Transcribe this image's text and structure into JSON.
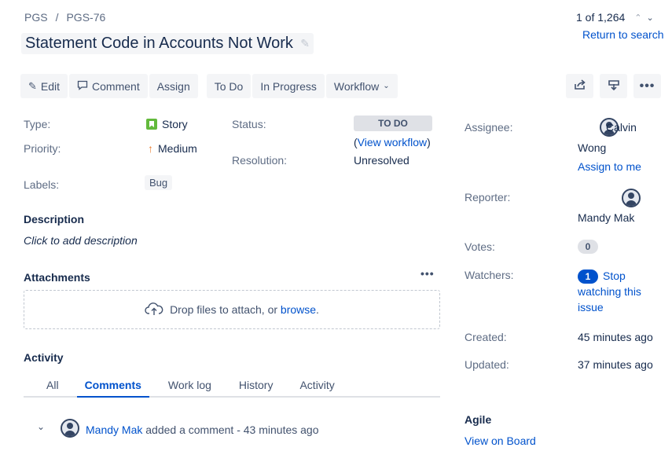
{
  "breadcrumb": {
    "project": "PGS",
    "separator": "/",
    "issue_key": "PGS-76"
  },
  "issue": {
    "title": "Statement Code in Accounts Not Work"
  },
  "pager": {
    "position": "1 of 1,264",
    "return_label": "Return to search"
  },
  "toolbar": {
    "edit": "Edit",
    "comment": "Comment",
    "assign": "Assign",
    "to_do": "To Do",
    "in_progress": "In Progress",
    "workflow": "Workflow"
  },
  "details": {
    "type_label": "Type:",
    "type_value": "Story",
    "priority_label": "Priority:",
    "priority_value": "Medium",
    "labels_label": "Labels:",
    "labels_value": "Bug",
    "status_label": "Status:",
    "status_value": "TO DO",
    "view_workflow_open": "(",
    "view_workflow": "View workflow",
    "view_workflow_close": ")",
    "resolution_label": "Resolution:",
    "resolution_value": "Unresolved"
  },
  "description": {
    "title": "Description",
    "placeholder": "Click to add description"
  },
  "attachments": {
    "title": "Attachments",
    "drop_text": "Drop files to attach, or ",
    "browse": "browse",
    "period": "."
  },
  "activity": {
    "title": "Activity",
    "tabs": [
      "All",
      "Comments",
      "Work log",
      "History",
      "Activity"
    ],
    "comment_author": "Mandy Mak",
    "comment_text": " added a comment - 43 minutes ago"
  },
  "people": {
    "assignee_label": "Assignee:",
    "assignee_first": "Calvin",
    "assignee_last": "Wong",
    "assign_to_me": "Assign to me",
    "reporter_label": "Reporter:",
    "reporter_name": "Mandy Mak",
    "votes_label": "Votes:",
    "votes_count": "0",
    "watchers_label": "Watchers:",
    "watchers_count": "1",
    "stop_watching_1": "Stop",
    "stop_watching_2": "watching this",
    "stop_watching_3": "issue"
  },
  "dates": {
    "created_label": "Created:",
    "created_value": "45 minutes ago",
    "updated_label": "Updated:",
    "updated_value": "37 minutes ago"
  },
  "agile": {
    "title": "Agile",
    "view_on_board": "View on Board"
  }
}
